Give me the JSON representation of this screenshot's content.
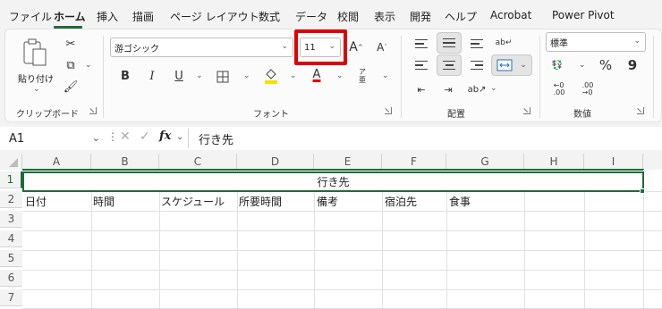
{
  "menu": [
    "ファイル",
    "ホーム",
    "挿入",
    "描画",
    "ページ レイアウト",
    "数式",
    "データ",
    "校閲",
    "表示",
    "開発",
    "ヘルプ",
    "Acrobat",
    "Power Pivot"
  ],
  "clipboard": {
    "paste_label": "貼り付け",
    "group_label": "クリップボード"
  },
  "font": {
    "name": "游ゴシック",
    "size": "11",
    "group_label": "フォント",
    "bold": "B",
    "italic": "I",
    "underline": "U",
    "color_letter": "A",
    "grow": "A",
    "shrink": "A",
    "phonetic": "ア",
    "phonetic2": "亜"
  },
  "align": {
    "group_label": "配置"
  },
  "number": {
    "format": "標準",
    "percent": "%",
    "comma": "9",
    "group_label": "数値"
  },
  "formula_bar": {
    "name_box": "A1",
    "fx": "fx",
    "content": "行き先"
  },
  "columns": [
    "A",
    "B",
    "C",
    "D",
    "E",
    "F",
    "G",
    "H",
    "I"
  ],
  "rows": [
    "1",
    "2",
    "3",
    "4",
    "5",
    "6",
    "7"
  ],
  "cells": {
    "merged_title": "行き先",
    "row2": [
      "日付",
      "時間",
      "スケジュール",
      "所要時間",
      "備考",
      "宿泊先",
      "食事"
    ]
  },
  "colors": {
    "accent": "#1e6b3a",
    "highlight_box": "#e00000",
    "font_color": "#e00000",
    "fill_color": "#f5e000"
  }
}
